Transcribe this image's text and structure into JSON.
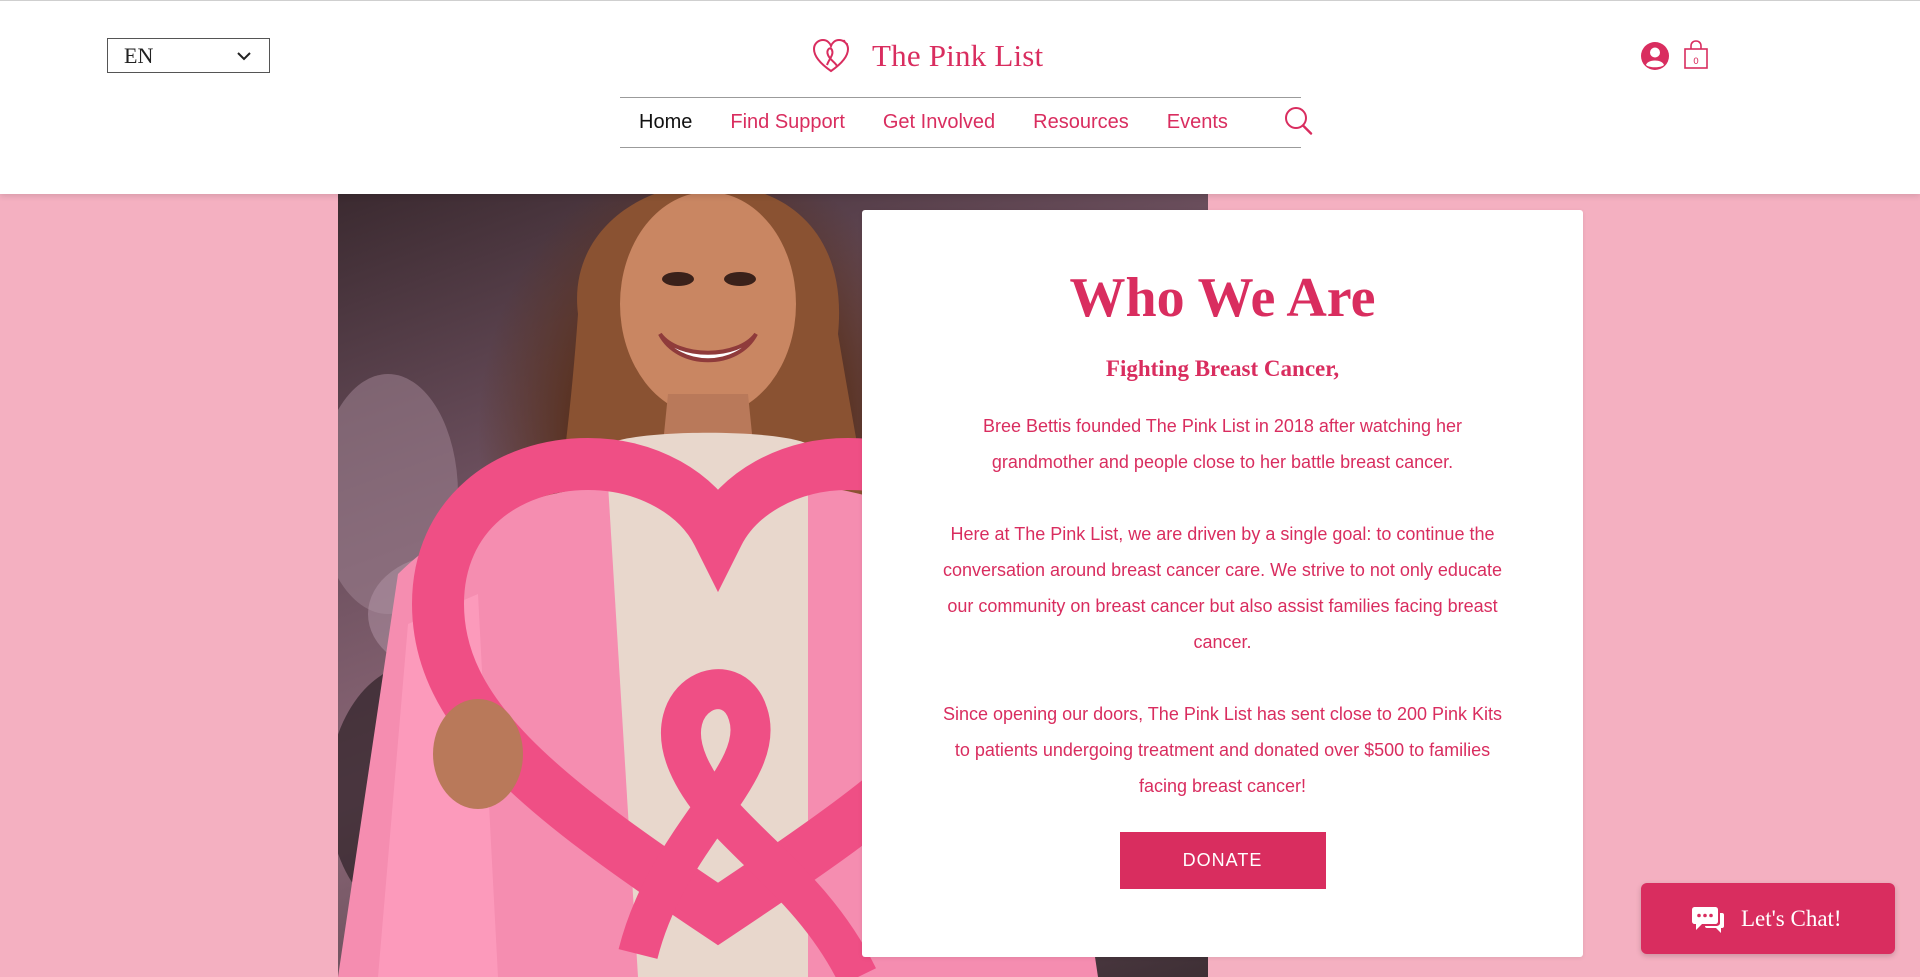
{
  "header": {
    "language": "EN",
    "site_title": "The Pink List",
    "nav": [
      {
        "label": "Home"
      },
      {
        "label": "Find Support"
      },
      {
        "label": "Get Involved"
      },
      {
        "label": "Resources"
      },
      {
        "label": "Events"
      }
    ],
    "active_nav": "Home",
    "icons": {
      "logo": "heart-ribbon-logo-icon",
      "account": "account-icon",
      "cart": "shopping-bag-icon",
      "cart_count": "0",
      "search": "search-icon"
    }
  },
  "hero": {
    "image_subject": "woman holding pink heart-ribbon sign"
  },
  "card": {
    "heading": "Who We Are",
    "subheading": "Fighting Breast Cancer,",
    "paragraphs": [
      "Bree Bettis founded The Pink List in 2018 after watching her grandmother and people close to her battle breast cancer.",
      "Here at The Pink List, we are driven by a single goal: to continue the conversation around breast cancer care. We strive to not only educate our community on breast cancer but also assist families facing breast cancer.",
      "Since opening our doors, The Pink List has sent close to 200 Pink Kits to patients undergoing treatment and donated over $500 to families facing breast cancer!"
    ],
    "donate_label": "DONATE"
  },
  "chat": {
    "label": "Let's Chat!",
    "icon": "chat-bubbles-icon"
  },
  "colors": {
    "brand_pink": "#d92d5f",
    "page_background": "#f4b0c1",
    "header_background": "#ffffff",
    "nav_active": "#111111"
  }
}
